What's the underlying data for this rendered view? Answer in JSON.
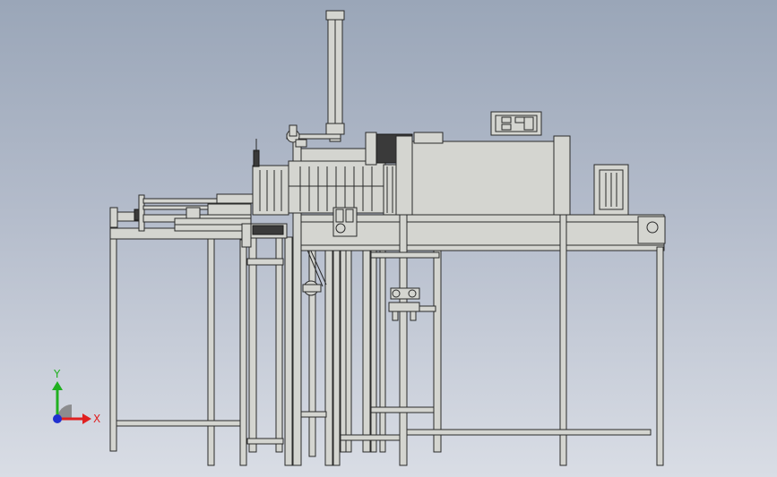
{
  "viewport": {
    "background_top": "#9aa6b8",
    "background_bottom": "#d9dde5"
  },
  "model": {
    "part_color": "#d4d5d0",
    "edge_color": "#2a2a2a",
    "dark_color": "#3a3a3a"
  },
  "triad": {
    "x_label": "X",
    "y_label": "Y",
    "x_color": "#e02020",
    "y_color": "#20b020",
    "origin_color": "#2030d0"
  }
}
